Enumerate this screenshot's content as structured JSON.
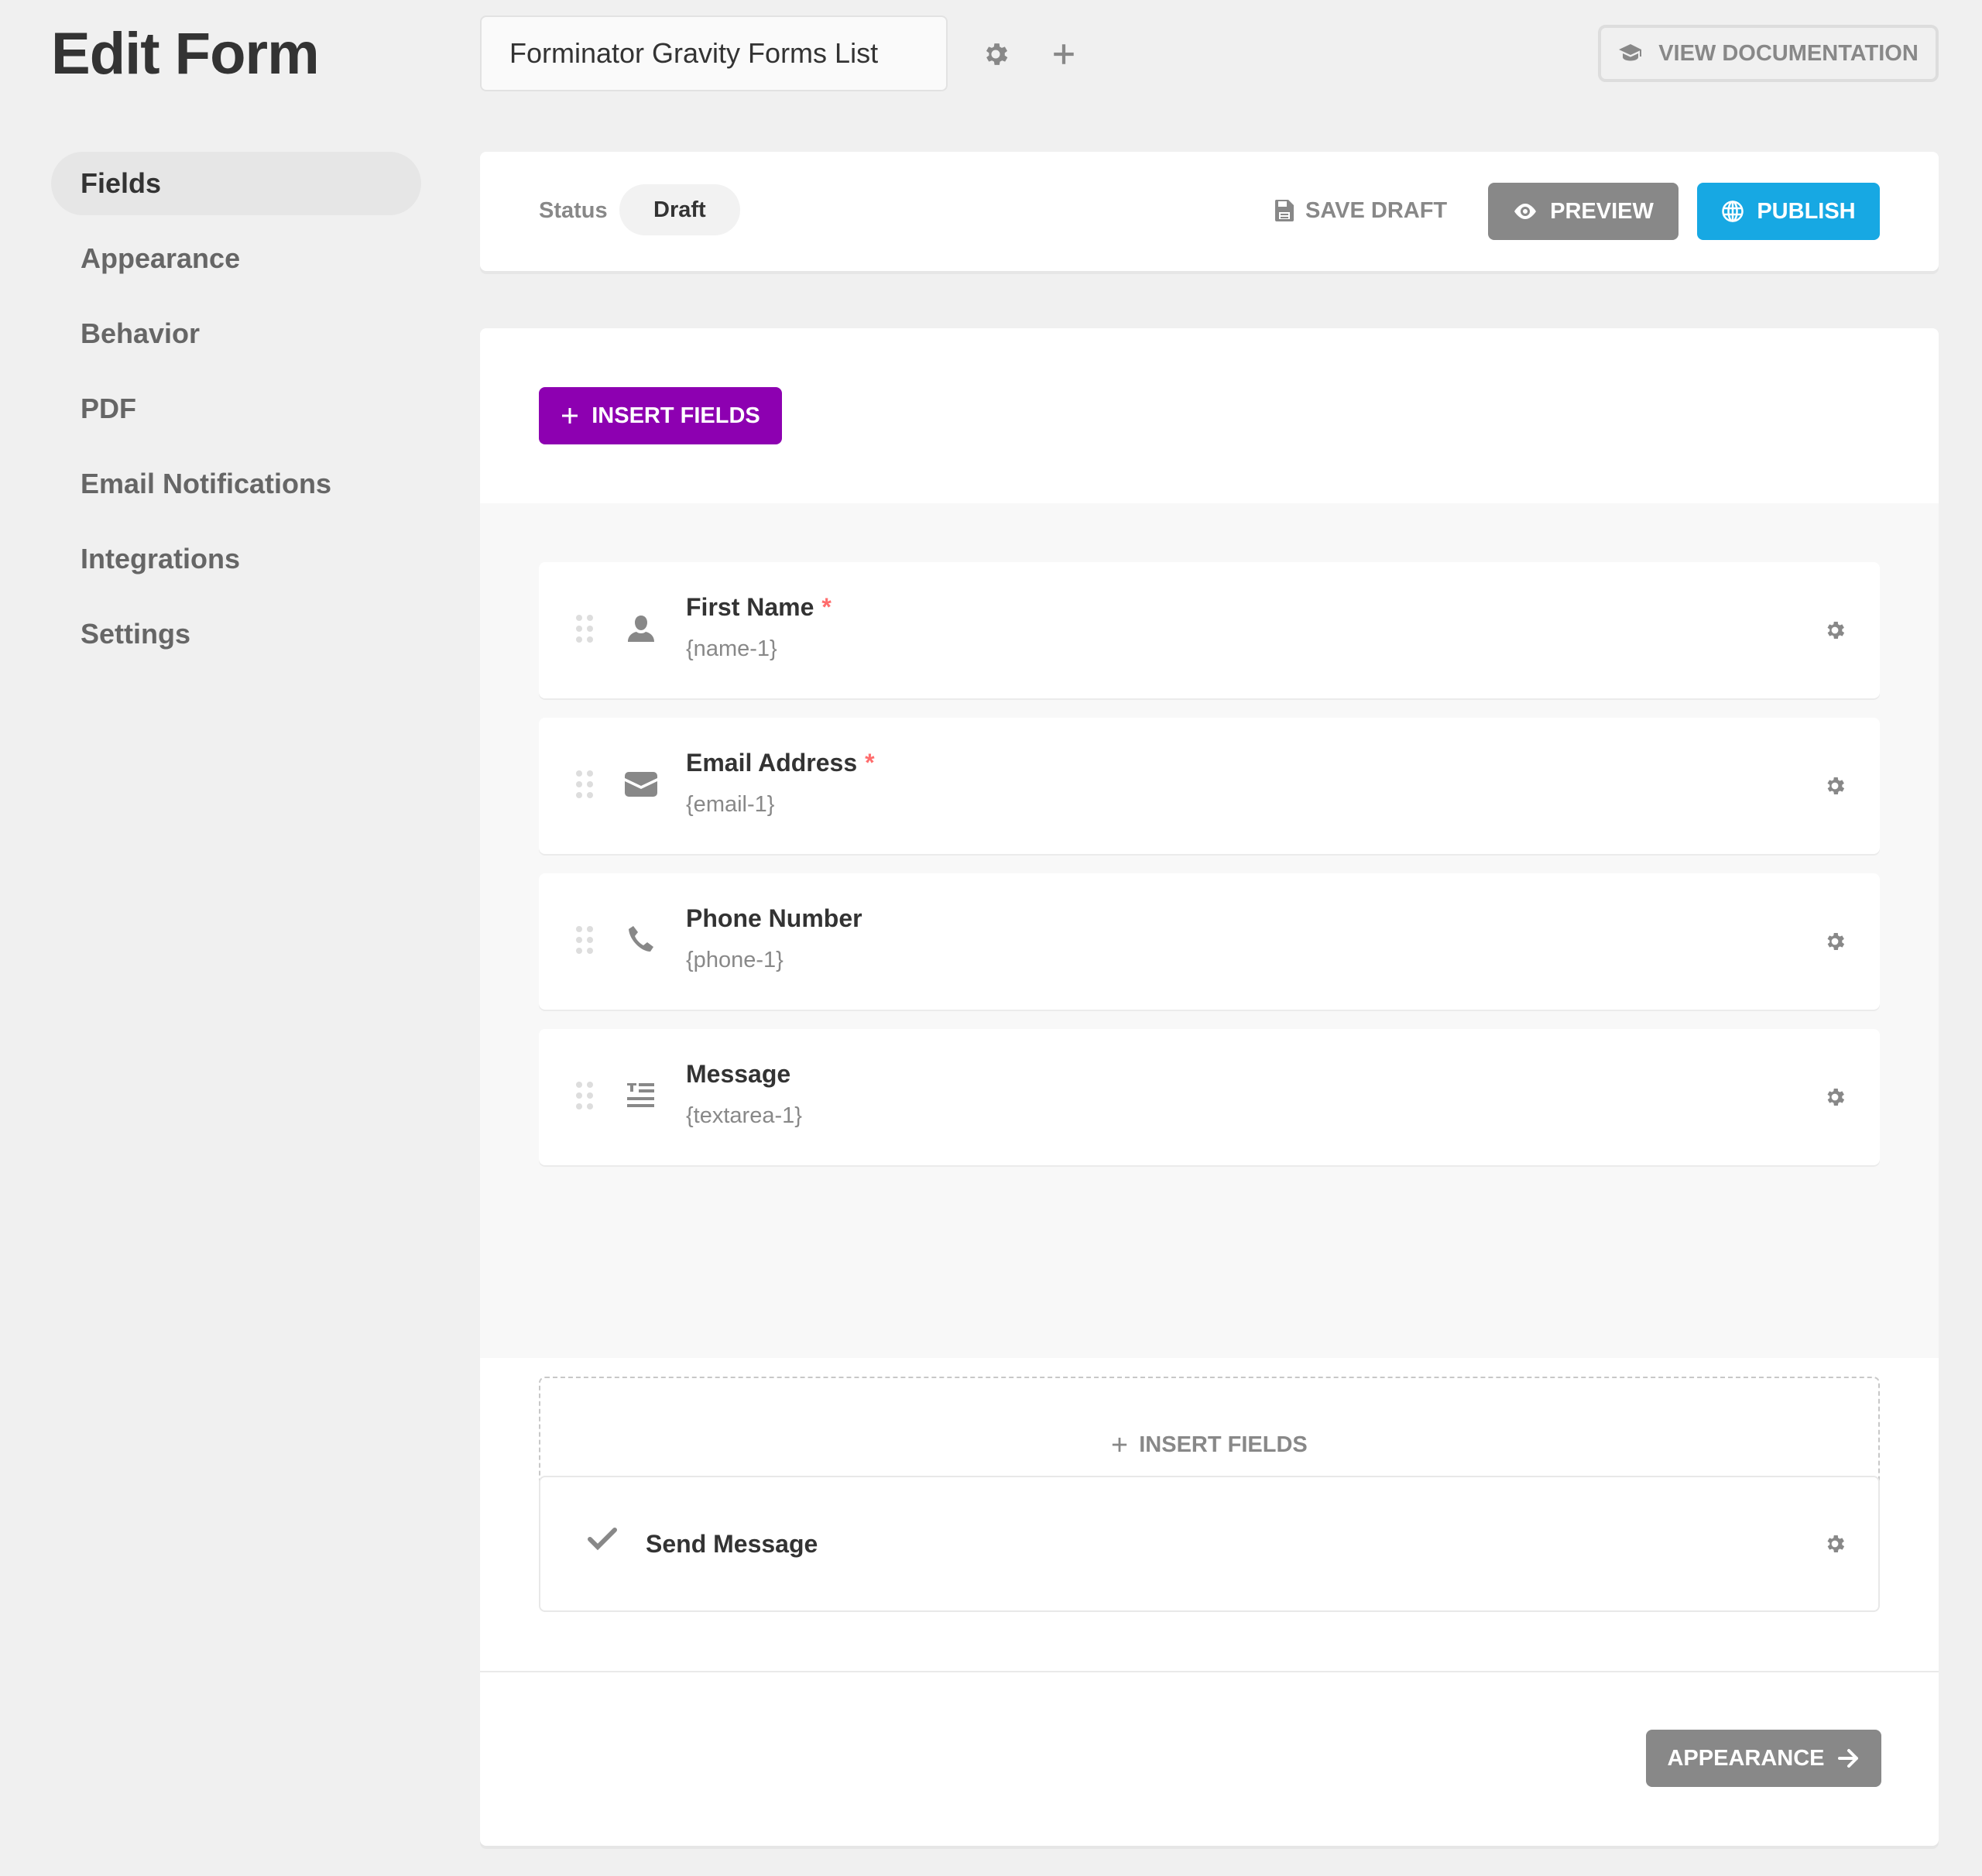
{
  "header": {
    "page_title": "Edit Form",
    "form_name": "Forminator Gravity Forms List",
    "settings_icon": "gear-icon",
    "add_icon": "plus-icon",
    "view_docs_label": "View Documentation",
    "view_docs_icon": "graduation-cap-icon"
  },
  "sidebar": {
    "items": [
      {
        "label": "Fields",
        "active": true
      },
      {
        "label": "Appearance",
        "active": false
      },
      {
        "label": "Behavior",
        "active": false
      },
      {
        "label": "PDF",
        "active": false
      },
      {
        "label": "Email Notifications",
        "active": false
      },
      {
        "label": "Integrations",
        "active": false
      },
      {
        "label": "Settings",
        "active": false
      }
    ]
  },
  "status_bar": {
    "status_label": "Status",
    "status_value": "Draft",
    "save_draft_label": "Save Draft",
    "save_draft_icon": "floppy-disk-icon",
    "preview_label": "Preview",
    "preview_icon": "eye-icon",
    "publish_label": "Publish",
    "publish_icon": "globe-icon"
  },
  "builder": {
    "insert_fields_label": "Insert Fields",
    "fields": [
      {
        "label": "First Name",
        "id": "{name-1}",
        "required": true,
        "icon": "user-icon"
      },
      {
        "label": "Email Address",
        "id": "{email-1}",
        "required": true,
        "icon": "envelope-icon"
      },
      {
        "label": "Phone Number",
        "id": "{phone-1}",
        "required": false,
        "icon": "phone-icon"
      },
      {
        "label": "Message",
        "id": "{textarea-1}",
        "required": false,
        "icon": "textarea-icon"
      }
    ],
    "required_marker": "*",
    "insert_fields_dashed_label": "Insert Fields",
    "submit": {
      "label": "Send Message",
      "icon": "checkmark-icon"
    },
    "next_button_label": "Appearance"
  },
  "colors": {
    "accent_purple": "#8d00b1",
    "publish_blue": "#17a8e3",
    "neutral_button": "#888888",
    "required_red": "#ff6d6d",
    "page_background": "#f0f0f0"
  }
}
